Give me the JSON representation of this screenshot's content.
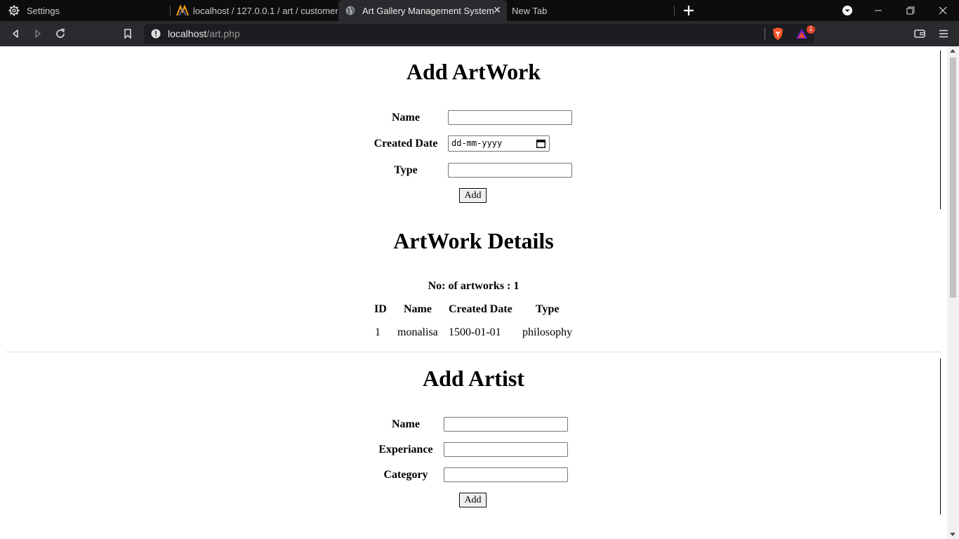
{
  "browser": {
    "tabs": [
      {
        "label": "Settings",
        "icon": "gear-icon",
        "active": false
      },
      {
        "label": "localhost / 127.0.0.1 / art / customer |",
        "icon": "phpmyadmin-icon",
        "active": false
      },
      {
        "label": "Art Gallery Management System",
        "icon": "globe-icon",
        "active": true
      },
      {
        "label": "New Tab",
        "icon": "",
        "active": false
      }
    ],
    "url_host": "localhost",
    "url_path": "/art.php",
    "rewards_badge": "1"
  },
  "artwork_form": {
    "title": "Add ArtWork",
    "name_label": "Name",
    "date_label": "Created Date",
    "date_placeholder": "dd-mm-yyyy",
    "type_label": "Type",
    "add_label": "Add"
  },
  "artwork_details": {
    "title": "ArtWork Details",
    "count_text": "No: of artworks : 1",
    "columns": [
      "ID",
      "Name",
      "Created Date",
      "Type"
    ],
    "rows": [
      [
        "1",
        "monalisa",
        "1500-01-01",
        "philosophy"
      ]
    ]
  },
  "artist_form": {
    "title": "Add Artist",
    "name_label": "Name",
    "experience_label": "Experiance",
    "category_label": "Category",
    "add_label": "Add"
  },
  "colors": {
    "tabbar_bg": "#0d0d0d",
    "toolbar_bg": "#2a2b2e",
    "brave_orange": "#fb542b"
  }
}
